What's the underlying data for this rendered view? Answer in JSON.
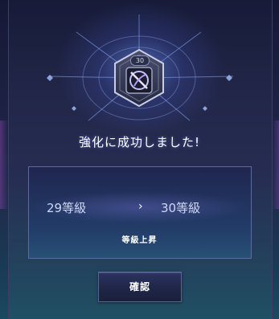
{
  "item": {
    "level_badge": "30",
    "icon": "crossed-blades-icon"
  },
  "dialog": {
    "title": "強化に成功しました!",
    "from_level": "29等級",
    "to_level": "30等級",
    "arrow": "›",
    "sub_label": "等級上昇",
    "confirm_label": "確認"
  },
  "colors": {
    "panel_top": "#171b38",
    "panel_bottom": "#1f5064",
    "accent_glow": "#6e96ff",
    "text_primary": "#ffffff",
    "text_secondary": "#cfd7f5"
  }
}
